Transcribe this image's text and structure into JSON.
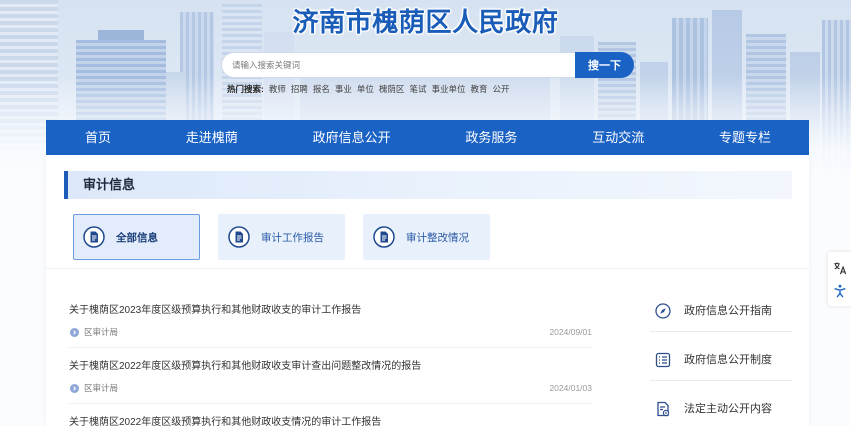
{
  "site": {
    "title": "济南市槐荫区人民政府"
  },
  "search": {
    "placeholder": "请输入搜索关键词",
    "button_label": "搜一下",
    "hot_label": "热门搜索:",
    "hot_terms": [
      "教师",
      "招聘",
      "报名",
      "事业",
      "单位",
      "槐荫区",
      "笔试",
      "事业单位",
      "教育",
      "公开"
    ]
  },
  "nav": {
    "items": [
      "首页",
      "走进槐荫",
      "政府信息公开",
      "政务服务",
      "互动交流",
      "专题专栏"
    ]
  },
  "section": {
    "title": "审计信息"
  },
  "tabs": [
    {
      "label": "全部信息",
      "active": true,
      "icon": "document-icon"
    },
    {
      "label": "审计工作报告",
      "active": false,
      "icon": "document-icon"
    },
    {
      "label": "审计整改情况",
      "active": false,
      "icon": "document-icon"
    }
  ],
  "articles": [
    {
      "title": "关于槐荫区2023年度区级预算执行和其他财政收支的审计工作报告",
      "source": "区审计局",
      "date": "2024/09/01"
    },
    {
      "title": "关于槐荫区2022年度区级预算执行和其他财政收支审计查出问题整改情况的报告",
      "source": "区审计局",
      "date": "2024/01/03"
    },
    {
      "title": "关于槐荫区2022年度区级预算执行和其他财政收支情况的审计工作报告"
    }
  ],
  "sidebar": {
    "links": [
      {
        "label": "政府信息公开指南",
        "icon": "compass-icon"
      },
      {
        "label": "政府信息公开制度",
        "icon": "list-icon"
      },
      {
        "label": "法定主动公开内容",
        "icon": "document-badge-icon"
      }
    ]
  },
  "tools": {
    "icons": [
      "translate-icon",
      "accessibility-icon"
    ]
  },
  "colors": {
    "primary": "#1b62c5",
    "title": "#1a5db8",
    "accent_bar": "#1c5cb8",
    "tab_active_bg": "#e2ecfa",
    "tab_active_border": "#6b9be0",
    "tab_bg": "#e8f0fb"
  }
}
